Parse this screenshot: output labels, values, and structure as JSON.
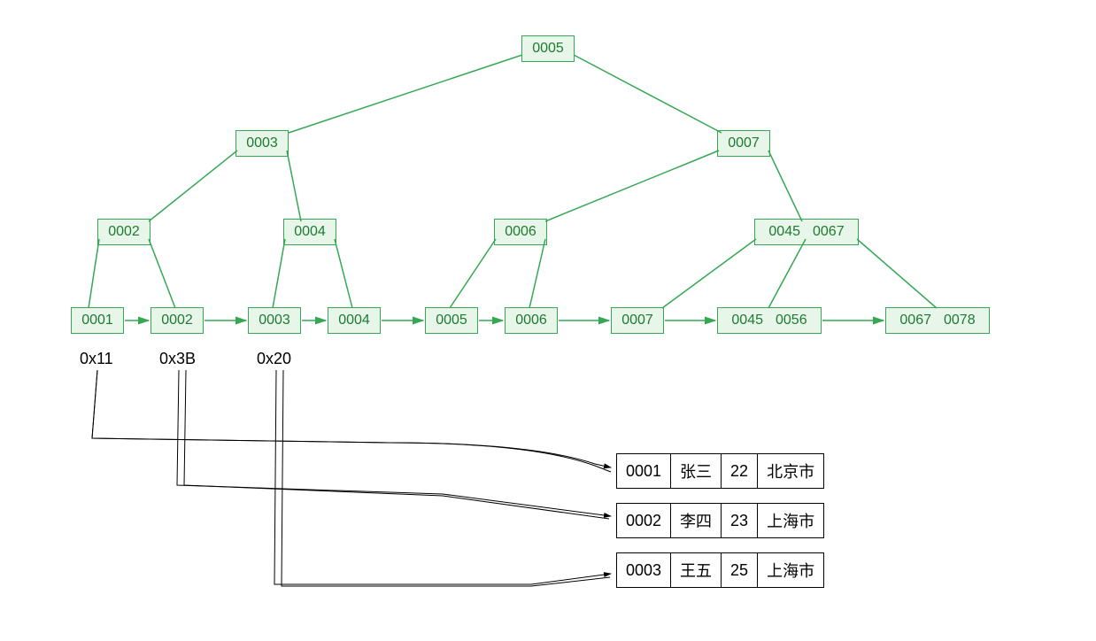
{
  "chart_data": {
    "type": "tree",
    "description": "B+ tree index with leaf linked list pointing to record rows",
    "root": {
      "id": "root",
      "keys": [
        "0005"
      ]
    },
    "internal_level_1": [
      {
        "id": "n3",
        "keys": [
          "0003"
        ]
      },
      {
        "id": "n7",
        "keys": [
          "0007"
        ]
      }
    ],
    "internal_level_2": [
      {
        "id": "n2",
        "keys": [
          "0002"
        ]
      },
      {
        "id": "n4",
        "keys": [
          "0004"
        ]
      },
      {
        "id": "n6",
        "keys": [
          "0006"
        ]
      },
      {
        "id": "n4567",
        "keys": [
          "0045",
          "0067"
        ]
      }
    ],
    "leaves": [
      {
        "id": "l1",
        "keys": [
          "0001"
        ],
        "pointer": "0x11"
      },
      {
        "id": "l2",
        "keys": [
          "0002"
        ],
        "pointer": "0x3B"
      },
      {
        "id": "l3",
        "keys": [
          "0003"
        ],
        "pointer": "0x20"
      },
      {
        "id": "l4",
        "keys": [
          "0004"
        ]
      },
      {
        "id": "l5",
        "keys": [
          "0005"
        ]
      },
      {
        "id": "l6",
        "keys": [
          "0006"
        ]
      },
      {
        "id": "l7",
        "keys": [
          "0007"
        ]
      },
      {
        "id": "l8",
        "keys": [
          "0045",
          "0056"
        ]
      },
      {
        "id": "l9",
        "keys": [
          "0067",
          "0078"
        ]
      }
    ],
    "records": [
      {
        "id": "r1",
        "key": "0001",
        "name": "张三",
        "age": "22",
        "city": "北京市"
      },
      {
        "id": "r2",
        "key": "0002",
        "name": "李四",
        "age": "23",
        "city": "上海市"
      },
      {
        "id": "r3",
        "key": "0003",
        "name": "王五",
        "age": "25",
        "city": "上海市"
      }
    ],
    "colors": {
      "node_fill": "#e8f5e9",
      "node_border": "#34a853",
      "node_text": "#1e7a33"
    }
  }
}
